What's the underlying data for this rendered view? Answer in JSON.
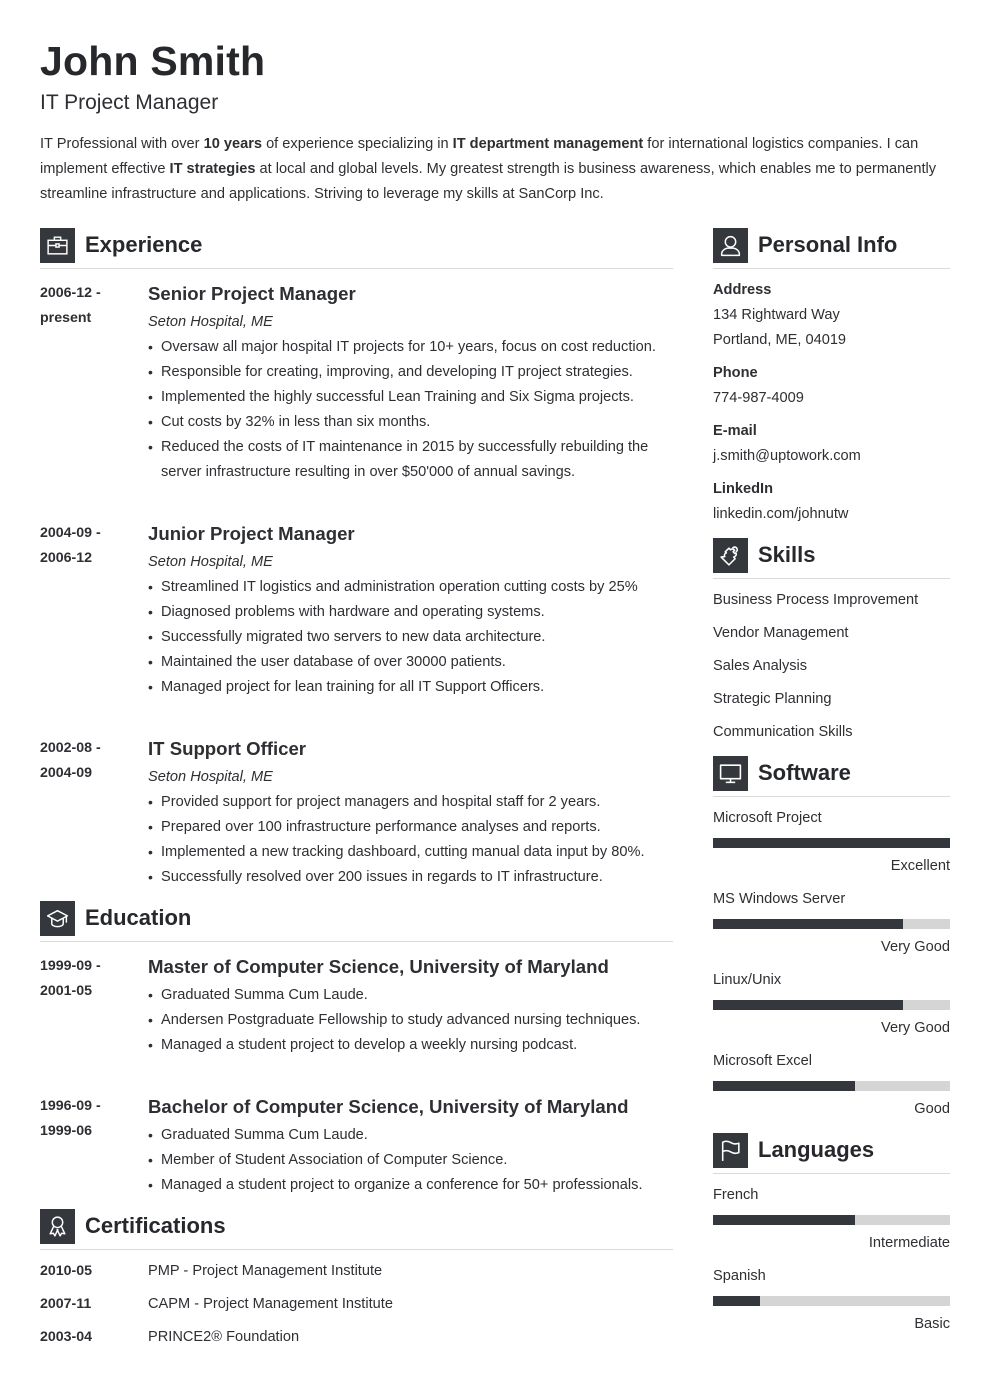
{
  "header": {
    "name": "John Smith",
    "job_title": "IT Project Manager",
    "summary": [
      {
        "text": "IT Professional with over ",
        "bold": false
      },
      {
        "text": "10 years",
        "bold": true
      },
      {
        "text": " of experience specializing in ",
        "bold": false
      },
      {
        "text": "IT department management",
        "bold": true
      },
      {
        "text": " for international logistics companies. I can implement effective ",
        "bold": false
      },
      {
        "text": "IT strategies",
        "bold": true
      },
      {
        "text": " at local and global levels. My greatest strength is business awareness, which enables me to permanently streamline infrastructure and applications. Striving to leverage my skills at SanCorp Inc.",
        "bold": false
      }
    ]
  },
  "experience": {
    "title": "Experience",
    "icon": "briefcase-icon",
    "entries": [
      {
        "date_start": "2006-12 -",
        "date_end": "present",
        "title": "Senior Project Manager",
        "company": "Seton Hospital, ME",
        "bullets": [
          "Oversaw all major hospital IT projects for 10+ years, focus on cost reduction.",
          "Responsible for creating, improving, and developing IT project strategies.",
          "Implemented the highly successful Lean Training and Six Sigma projects.",
          "Cut costs by 32% in less than six months.",
          "Reduced the costs of IT maintenance in 2015 by successfully rebuilding the server infrastructure resulting in over $50'000 of annual savings."
        ]
      },
      {
        "date_start": "2004-09 -",
        "date_end": "2006-12",
        "title": "Junior Project Manager",
        "company": "Seton Hospital, ME",
        "bullets": [
          "Streamlined IT logistics and administration operation cutting costs by 25%",
          "Diagnosed problems with hardware and operating systems.",
          "Successfully migrated two servers to new data architecture.",
          "Maintained the user database of over 30000 patients.",
          "Managed project for lean training for all IT Support Officers."
        ]
      },
      {
        "date_start": "2002-08 -",
        "date_end": "2004-09",
        "title": "IT Support Officer",
        "company": "Seton Hospital, ME",
        "bullets": [
          "Provided support for project managers and hospital staff for 2 years.",
          "Prepared over 100 infrastructure performance analyses and reports.",
          "Implemented a new tracking dashboard, cutting manual data input by 80%.",
          "Successfully resolved over 200 issues in regards to IT infrastructure."
        ]
      }
    ]
  },
  "education": {
    "title": "Education",
    "icon": "graduation-cap-icon",
    "entries": [
      {
        "date_start": "1999-09 -",
        "date_end": "2001-05",
        "title": "Master of Computer Science, University of Maryland",
        "bullets": [
          "Graduated Summa Cum Laude.",
          "Andersen Postgraduate Fellowship to study advanced nursing techniques.",
          "Managed a student project to develop a weekly nursing podcast."
        ]
      },
      {
        "date_start": "1996-09 -",
        "date_end": "1999-06",
        "title": "Bachelor of Computer Science, University of Maryland",
        "bullets": [
          "Graduated Summa Cum Laude.",
          "Member of Student Association of Computer Science.",
          "Managed a student project to organize a conference for 50+ professionals."
        ]
      }
    ]
  },
  "certifications": {
    "title": "Certifications",
    "icon": "award-ribbon-icon",
    "items": [
      {
        "date": "2010-05",
        "name": "PMP - Project Management Institute"
      },
      {
        "date": "2007-11",
        "name": "CAPM - Project Management Institute"
      },
      {
        "date": "2003-04",
        "name": "PRINCE2® Foundation"
      }
    ]
  },
  "personal_info": {
    "title": "Personal Info",
    "icon": "user-icon",
    "address_label": "Address",
    "address_line1": "134 Rightward Way",
    "address_line2": "Portland, ME, 04019",
    "phone_label": "Phone",
    "phone": "774-987-4009",
    "email_label": "E-mail",
    "email": "j.smith@uptowork.com",
    "linkedin_label": "LinkedIn",
    "linkedin": "linkedin.com/johnutw"
  },
  "skills": {
    "title": "Skills",
    "icon": "puzzle-piece-icon",
    "items": [
      "Business Process Improvement",
      "Vendor Management",
      "Sales Analysis",
      "Strategic Planning",
      "Communication Skills"
    ]
  },
  "software": {
    "title": "Software",
    "icon": "monitor-icon",
    "items": [
      {
        "name": "Microsoft Project",
        "level": "Excellent",
        "fraction": 1.0
      },
      {
        "name": "MS Windows Server",
        "level": "Very Good",
        "fraction": 0.8
      },
      {
        "name": "Linux/Unix",
        "level": "Very Good",
        "fraction": 0.8
      },
      {
        "name": "Microsoft Excel",
        "level": "Good",
        "fraction": 0.6
      }
    ]
  },
  "languages": {
    "title": "Languages",
    "icon": "flag-icon",
    "items": [
      {
        "name": "French",
        "level": "Intermediate",
        "fraction": 0.6
      },
      {
        "name": "Spanish",
        "level": "Basic",
        "fraction": 0.2
      }
    ]
  },
  "colors": {
    "icon_bg": "#34373c",
    "text": "#2d2f33",
    "bar_fill": "#34373c",
    "bar_track": "#d5d5d5",
    "rule": "#d9d9d9"
  }
}
